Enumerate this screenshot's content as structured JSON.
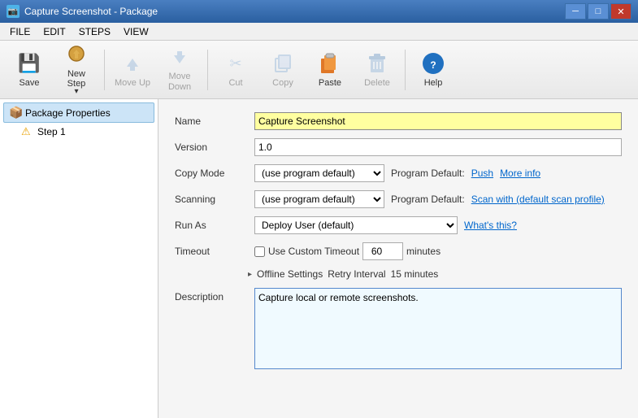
{
  "titleBar": {
    "title": "Capture Screenshot - Package",
    "controls": {
      "minimize": "─",
      "maximize": "□",
      "close": "✕"
    }
  },
  "menuBar": {
    "items": [
      "FILE",
      "EDIT",
      "STEPS",
      "VIEW"
    ]
  },
  "toolbar": {
    "buttons": [
      {
        "id": "save",
        "label": "Save",
        "icon": "💾",
        "disabled": false
      },
      {
        "id": "new-step",
        "label": "New Step",
        "icon": "🔁",
        "disabled": false,
        "hasDropdown": true
      },
      {
        "id": "move-up",
        "label": "Move Up",
        "icon": "↑",
        "disabled": true
      },
      {
        "id": "move-down",
        "label": "Move Down",
        "icon": "↓",
        "disabled": true
      },
      {
        "id": "cut",
        "label": "Cut",
        "icon": "✂",
        "disabled": true
      },
      {
        "id": "copy",
        "label": "Copy",
        "icon": "⧉",
        "disabled": true
      },
      {
        "id": "paste",
        "label": "Paste",
        "icon": "📋",
        "disabled": false
      },
      {
        "id": "delete",
        "label": "Delete",
        "icon": "🗑",
        "disabled": true
      },
      {
        "id": "help",
        "label": "Help",
        "icon": "❓",
        "disabled": false
      }
    ]
  },
  "sidebar": {
    "items": [
      {
        "id": "package-properties",
        "label": "Package Properties",
        "icon": "📦",
        "selected": false,
        "level": 0
      },
      {
        "id": "step-1",
        "label": "Step 1",
        "icon": "⚠",
        "selected": false,
        "level": 1
      }
    ]
  },
  "form": {
    "nameLabel": "Name",
    "nameValue": "Capture Screenshot",
    "versionLabel": "Version",
    "versionValue": "1.0",
    "copyModeLabel": "Copy Mode",
    "copyModeValue": "(use program default)",
    "copyModeNote": "Program Default:",
    "copyModeLink1": "Push",
    "copyModeLink2": "More info",
    "scanningLabel": "Scanning",
    "scanningValue": "(use program default)",
    "scanningNote": "Program Default:",
    "scanningLink": "Scan with (default scan profile)",
    "runAsLabel": "Run As",
    "runAsValue": "Deploy User (default)",
    "runAsLink": "What's this?",
    "timeoutLabel": "Timeout",
    "timeoutCheckLabel": "Use Custom Timeout",
    "timeoutValue": "60",
    "timeoutUnit": "minutes",
    "offlineToggle": "▸",
    "offlineLabel": "Offline Settings",
    "offlineRetry": "Retry Interval",
    "offlineRetryValue": "15 minutes",
    "descriptionLabel": "Description",
    "descriptionValue": "Capture local or remote screenshots."
  }
}
